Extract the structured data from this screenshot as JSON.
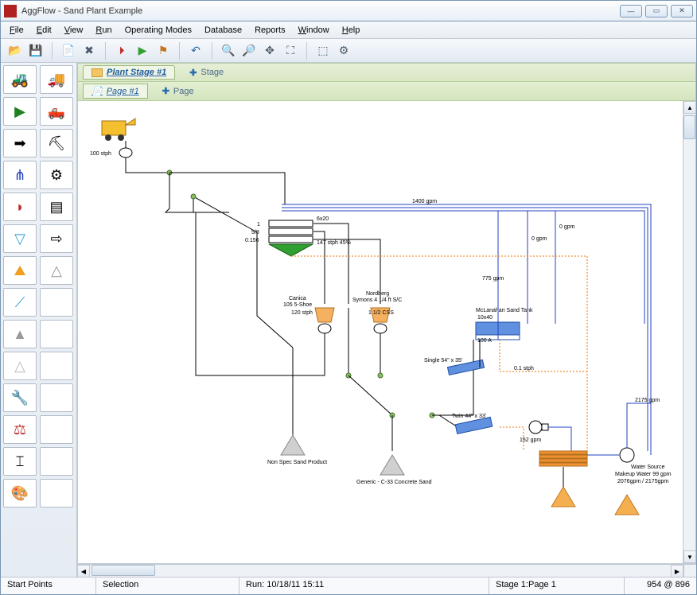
{
  "window": {
    "title": "AggFlow - Sand Plant Example"
  },
  "menu": {
    "file": "File",
    "edit": "Edit",
    "view": "View",
    "run": "Run",
    "opmodes": "Operating Modes",
    "database": "Database",
    "reports": "Reports",
    "window": "Window",
    "help": "Help"
  },
  "tabs": {
    "stage": "Plant Stage #1",
    "addstage": "Stage",
    "page": "Page #1",
    "addpage": "Page"
  },
  "canvas": {
    "feed_rate": "100 stph",
    "screen_deck1": "1",
    "screen_deck2": "5/8",
    "screen_deck3": "0.156",
    "screen_size": "6x20",
    "screen_out": "147 stph   45%",
    "canica_name": "Canica",
    "canica_model": "105 5-Shoe",
    "canica_rate": "120 stph",
    "nordberg_name": "Nordberg",
    "nordberg_model": "Symons 4 1/4 ft S/C",
    "nordberg_css": "1 1/2 CSS",
    "tank_name": "McLanahan Sand Tank",
    "tank_size": "10x40",
    "tank_rate": "100 A",
    "screw1": "Single 54\" x 35'",
    "screw2": "Twin 44\" x 33'",
    "pump_gpm": "152 gpm",
    "flow_1400": "1400 gpm",
    "flow_775": "775 gpm",
    "flow_0a": "0 gpm",
    "flow_0b": "0 gpm",
    "flow_2175": "2175 gpm",
    "flow_01stph": "0.1 stph",
    "pile_nonspec": "Non Spec Sand Product",
    "pile_concrete": "Generic - C-33 Concrete Sand",
    "water_src": "Water Source",
    "water_makeup": "Makeup Water 99 gpm",
    "water_total": "2076gpm / 2175gpm"
  },
  "status": {
    "startpoints": "Start Points",
    "selection": "Selection",
    "run": "Run: 10/18/11 15:11",
    "stagepage": "Stage 1:Page 1",
    "coords": "954 @ 896"
  }
}
